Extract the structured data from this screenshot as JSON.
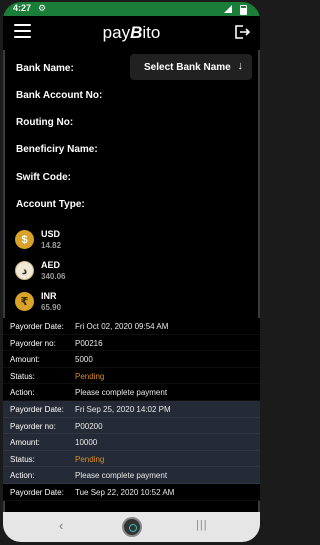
{
  "status_bar": {
    "time": "4:27",
    "gear": "⚙"
  },
  "header": {
    "brand_pre": "pay",
    "brand_b": "B",
    "brand_post": "ito"
  },
  "form": {
    "bank_name_label": "Bank Name:",
    "bank_select_value": "Select Bank Name",
    "account_no_label": "Bank Account No:",
    "routing_label": "Routing No:",
    "beneficiary_label": "Beneficiry Name:",
    "swift_label": "Swift Code:",
    "account_type_label": "Account Type:"
  },
  "balances": [
    {
      "currency": "USD",
      "amount": "14.82",
      "icon": "dollar-coin-icon",
      "glyph": "$"
    },
    {
      "currency": "AED",
      "amount": "340.06",
      "icon": "aed-coin-icon",
      "glyph": "د"
    },
    {
      "currency": "INR",
      "amount": "65.90",
      "icon": "rupee-coin-icon",
      "glyph": "₹"
    }
  ],
  "orders": [
    {
      "date_label": "Payorder Date:",
      "date": "Fri Oct 02, 2020 09:54 AM",
      "no_label": "Payorder no:",
      "no": "P00216",
      "amount_label": "Amount:",
      "amount": "5000",
      "status_label": "Status:",
      "status": "Pending",
      "action_label": "Action:",
      "action": "Please complete payment"
    },
    {
      "date_label": "Payorder Date:",
      "date": "Fri Sep 25, 2020 14:02 PM",
      "no_label": "Payorder no:",
      "no": "P00200",
      "amount_label": "Amount:",
      "amount": "10000",
      "status_label": "Status:",
      "status": "Pending",
      "action_label": "Action:",
      "action": "Please complete payment"
    },
    {
      "date_label": "Payorder Date:",
      "date": "Tue Sep 22, 2020 10:52 AM"
    }
  ],
  "navbar": {
    "back": "‹",
    "recent": "|||"
  },
  "colors": {
    "status_bar": "#1a7d38",
    "pending": "#d98a28",
    "alt_row": "#242b36",
    "coin_gold": "#d9a228"
  }
}
